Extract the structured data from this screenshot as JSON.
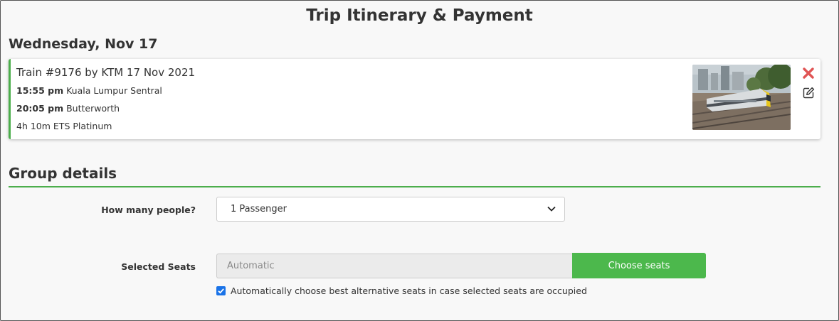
{
  "page": {
    "title": "Trip Itinerary & Payment"
  },
  "itinerary": {
    "date_heading": "Wednesday, Nov 17",
    "trip": {
      "title": "Train #9176 by KTM 17 Nov 2021",
      "departure_time": "15:55 pm",
      "departure_station": "Kuala Lumpur Sentral",
      "arrival_time": "20:05 pm",
      "arrival_station": "Butterworth",
      "duration_class": "4h 10m ETS Platinum",
      "photo_icon": "train-photo",
      "remove_icon": "close-icon",
      "edit_icon": "edit-icon"
    }
  },
  "group_details": {
    "heading": "Group details",
    "people_label": "How many people?",
    "people_value": "1 Passenger",
    "seats_label": "Selected Seats",
    "seats_placeholder": "Automatic",
    "choose_seats_label": "Choose seats",
    "auto_choose_label": "Automatically choose best alternative seats in case selected seats are occupied",
    "auto_choose_checked": true
  },
  "colors": {
    "accent_green": "#4cae4c",
    "button_green": "#4cb84c",
    "remove_red": "#e05454",
    "checkbox_blue": "#1a73e8"
  }
}
